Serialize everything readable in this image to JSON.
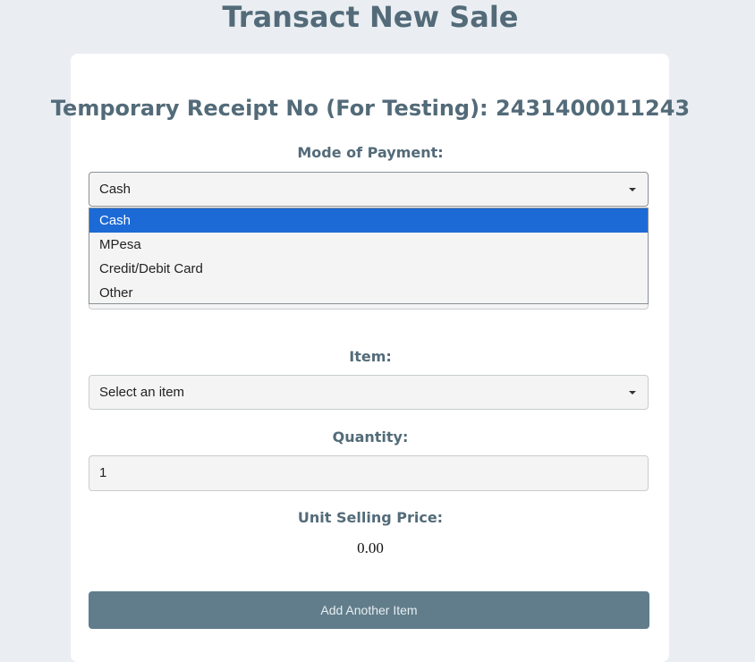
{
  "page": {
    "title": "Transact New Sale",
    "receipt_heading": "Temporary Receipt No (For Testing): 2431400011243"
  },
  "payment": {
    "label": "Mode of Payment:",
    "selected": "Cash",
    "options": [
      "Cash",
      "MPesa",
      "Credit/Debit Card",
      "Other"
    ]
  },
  "item": {
    "label": "Item:",
    "selected": "Select an item"
  },
  "quantity": {
    "label": "Quantity:",
    "value": "1"
  },
  "unit_price": {
    "label": "Unit Selling Price:",
    "value": "0.00"
  },
  "actions": {
    "add_item_label": "Add Another Item"
  },
  "colors": {
    "background": "#eaeef2",
    "heading": "#536b79",
    "selected_option": "#1c6ad6",
    "button": "#617d8b"
  }
}
